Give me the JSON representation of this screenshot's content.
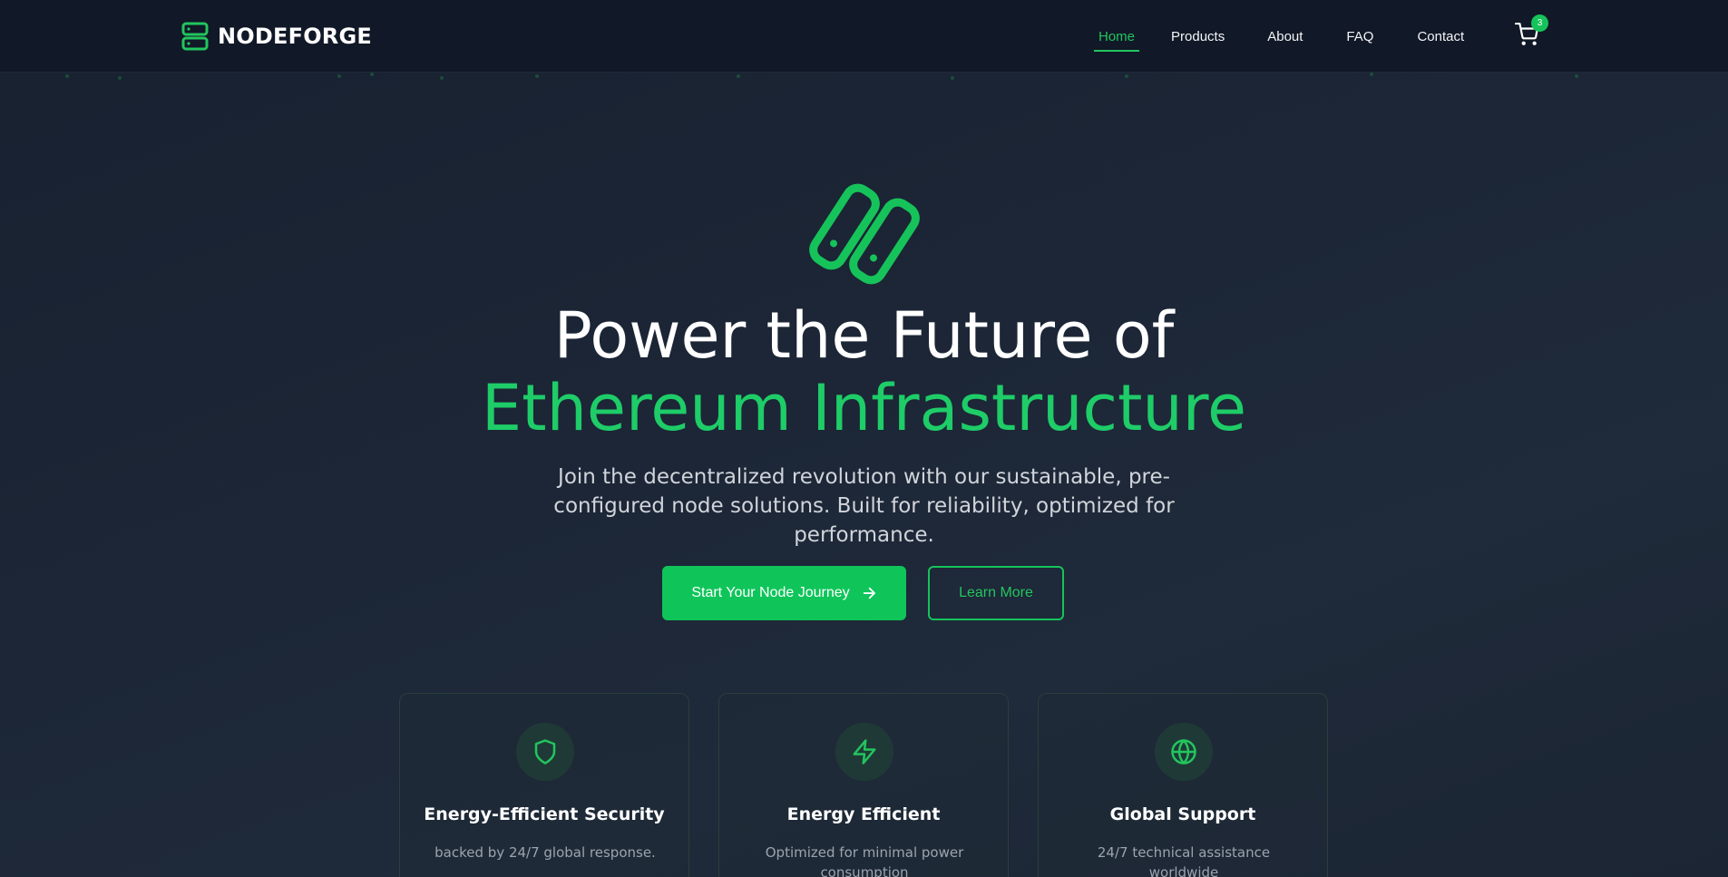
{
  "brand": {
    "name": "NODEFORGE",
    "accent": "#22c55e"
  },
  "nav": {
    "links": [
      {
        "label": "Home",
        "active": true
      },
      {
        "label": "Products",
        "active": false
      },
      {
        "label": "About",
        "active": false
      },
      {
        "label": "FAQ",
        "active": false
      },
      {
        "label": "Contact",
        "active": false
      }
    ],
    "cart_icon": "shopping-cart-icon",
    "cart_count": "3"
  },
  "hero": {
    "icon": "server-nodes-icon",
    "title_line1": "Power the Future of",
    "title_line2": "Ethereum Infrastructure",
    "subtitle": "Join the decentralized revolution with our sustainable, pre-configured node solutions. Built for reliability, optimized for performance.",
    "primary_button": "Start Your Node Journey",
    "primary_button_icon": "arrow-right-icon",
    "secondary_button": "Learn More"
  },
  "features": [
    {
      "icon": "shield-icon",
      "title": "Energy-Efficient Security",
      "text": "backed by 24/7 global response."
    },
    {
      "icon": "lightning-icon",
      "title": "Energy Efficient",
      "text": "Optimized for minimal power consumption"
    },
    {
      "icon": "globe-icon",
      "title": "Global Support",
      "text": "24/7 technical assistance worldwide"
    }
  ]
}
